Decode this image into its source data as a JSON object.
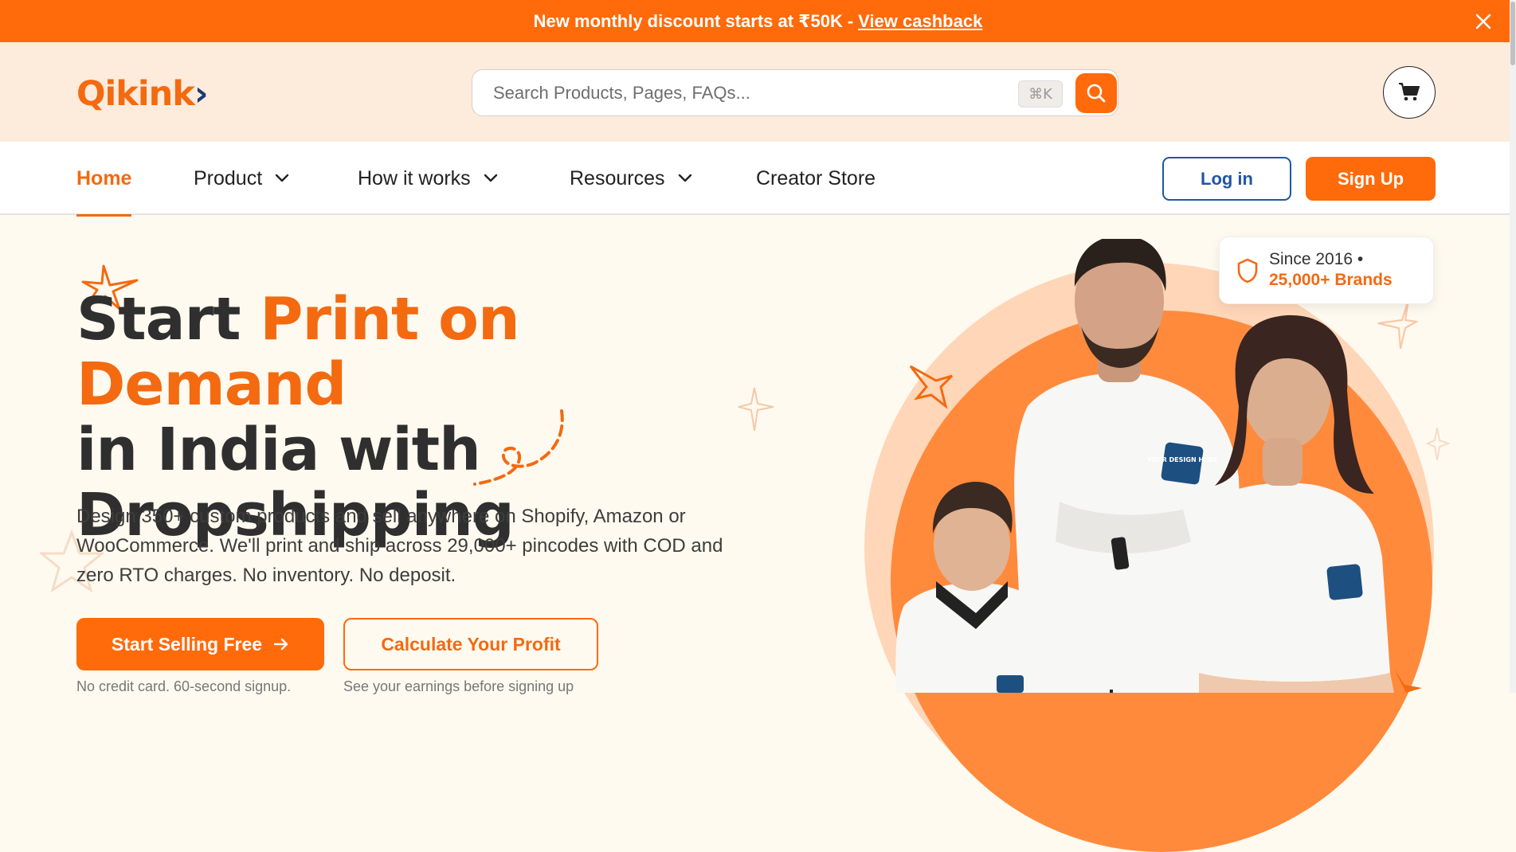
{
  "promo": {
    "text": "New monthly discount starts at ₹50K",
    "separator": "-",
    "link": "View cashback"
  },
  "header": {
    "logo_text": "Qikink",
    "search_placeholder": "Search Products, Pages, FAQs...",
    "shortcut": "⌘K"
  },
  "nav": {
    "items": [
      {
        "label": "Home",
        "active": true
      },
      {
        "label": "Product",
        "dropdown": true
      },
      {
        "label": "How it works",
        "dropdown": true
      },
      {
        "label": "Resources",
        "dropdown": true
      },
      {
        "label": "Creator Store"
      }
    ],
    "login": "Log in",
    "signup": "Sign Up"
  },
  "hero": {
    "title_start": "Start",
    "title_highlight": "Print on Demand",
    "title_line2": "in India with",
    "title_line3": "Dropshipping",
    "description": "Design 350+ custom products and sell anywhere on Shopify, Amazon or WooCommerce. We'll print and ship across 29,000+ pincodes with COD and zero RTO charges. No inventory. No deposit.",
    "cta_primary": "Start Selling Free",
    "cta_secondary": "Calculate Your Profit",
    "note_primary": "No credit card. 60-second signup.",
    "note_secondary": "See your earnings before signing up"
  },
  "badge": {
    "line1": "Since 2016 •",
    "line2": "25,000+ Brands"
  },
  "print_label": "YOUR DESIGN HERE",
  "colors": {
    "accent": "#ff6a0a",
    "header_bg": "#fdebdc",
    "hero_bg": "#fffaf0",
    "login_blue": "#1f56a5"
  }
}
